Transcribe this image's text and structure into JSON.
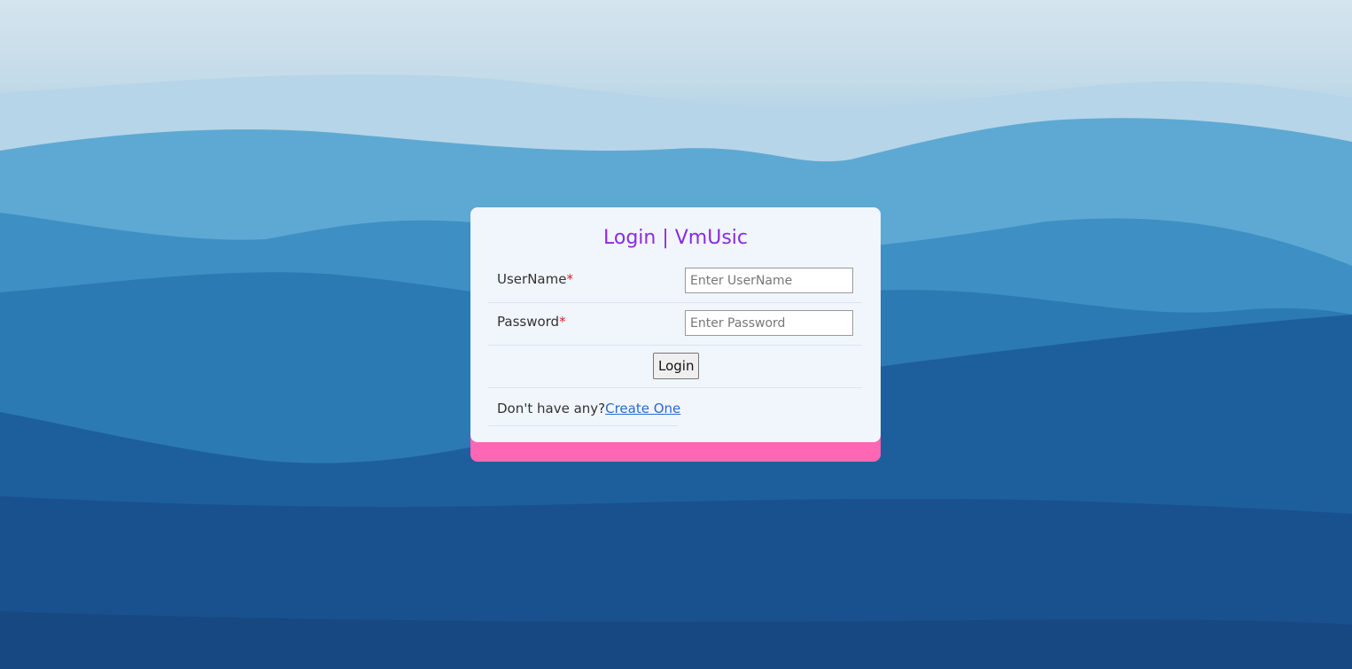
{
  "login_card": {
    "title": "Login | VmUsic",
    "username_label": "UserName",
    "username_placeholder": "Enter UserName",
    "username_value": "",
    "password_label": "Password",
    "password_placeholder": "Enter Password",
    "password_value": "",
    "required_marker": "*",
    "login_button": "Login",
    "signup_prompt": "Don't have any?",
    "signup_link": "Create One"
  },
  "colors": {
    "title": "#8a2be2",
    "card_background": "#f0f6fc",
    "card_accent": "#ff66b3",
    "link": "#2a6bd1",
    "required": "#e02020"
  }
}
